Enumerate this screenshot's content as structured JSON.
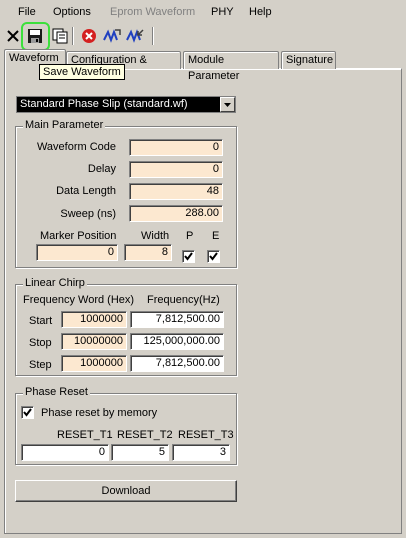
{
  "menu": {
    "file": "File",
    "options": "Options",
    "eprom_waveform": "Eprom Waveform",
    "phy": "PHY",
    "help": "Help"
  },
  "tooltip": "Save Waveform",
  "tabs": [
    "Waveform",
    "Configuration & Status",
    "Module Parameter",
    "Signature"
  ],
  "waveform_select": "Standard Phase Slip (standard.wf)",
  "main_parameter": {
    "title": "Main Parameter",
    "waveform_code_label": "Waveform Code",
    "waveform_code": "0",
    "delay_label": "Delay",
    "delay": "0",
    "data_length_label": "Data Length",
    "data_length": "48",
    "sweep_label": "Sweep (ns)",
    "sweep": "288.00",
    "marker_position_label": "Marker Position",
    "marker_position": "0",
    "width_label": "Width",
    "width": "8",
    "p_label": "P",
    "e_label": "E",
    "p_checked": true,
    "e_checked": true
  },
  "linear_chirp": {
    "title": "Linear Chirp",
    "freq_word_header": "Frequency Word (Hex)",
    "freq_hz_header": "Frequency(Hz)",
    "rows": [
      {
        "label": "Start",
        "word": "1000000",
        "hz": "7,812,500.00"
      },
      {
        "label": "Stop",
        "word": "10000000",
        "hz": "125,000,000.00"
      },
      {
        "label": "Step",
        "word": "1000000",
        "hz": "7,812,500.00"
      }
    ]
  },
  "phase_reset": {
    "title": "Phase Reset",
    "by_memory_label": "Phase reset by memory",
    "by_memory_checked": true,
    "t1_label": "RESET_T1",
    "t2_label": "RESET_T2",
    "t3_label": "RESET_T3",
    "t1": "0",
    "t2": "5",
    "t3": "3"
  },
  "download_label": "Download",
  "colors": {
    "face": "#d4d0c8",
    "field": "#fce8d0",
    "highlight": "#3ce03c",
    "tooltip_bg": "#ffffe1"
  }
}
